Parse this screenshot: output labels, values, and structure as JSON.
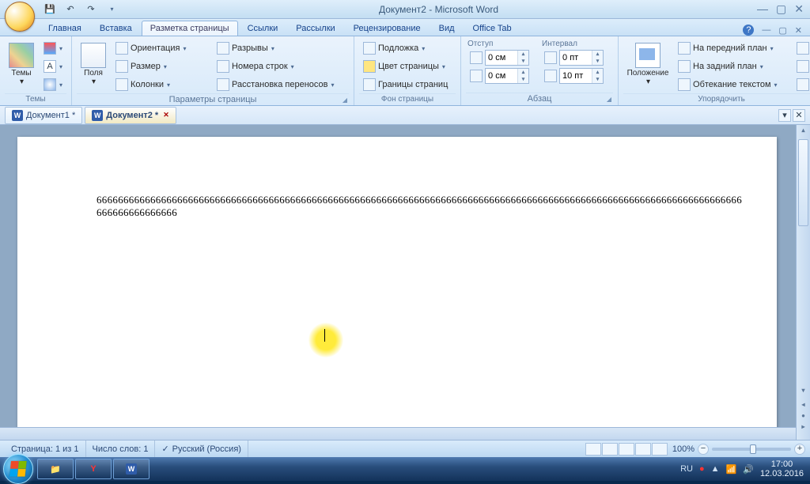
{
  "title": "Документ2 - Microsoft Word",
  "tabs": {
    "items": [
      "Главная",
      "Вставка",
      "Разметка страницы",
      "Ссылки",
      "Рассылки",
      "Рецензирование",
      "Вид",
      "Office Tab"
    ],
    "active": 2
  },
  "groups": {
    "themes": {
      "label": "Темы",
      "big": "Темы"
    },
    "page": {
      "label": "Параметры страницы",
      "big": "Поля",
      "orient": "Ориентация",
      "size": "Размер",
      "cols": "Колонки",
      "breaks": "Разрывы",
      "lines": "Номера строк",
      "hyphen": "Расстановка переносов"
    },
    "bg": {
      "label": "Фон страницы",
      "water": "Подложка",
      "color": "Цвет страницы",
      "border": "Границы страниц"
    },
    "para": {
      "label": "Абзац",
      "indent": "Отступ",
      "spacing": "Интервал",
      "left": "0 см",
      "right": "0 см",
      "before": "0 пт",
      "after": "10 пт"
    },
    "arrange": {
      "label": "Упорядочить",
      "pos": "Положение",
      "front": "На передний план",
      "back": "На задний план",
      "wrap": "Обтекание текстом"
    }
  },
  "docTabs": [
    {
      "name": "Документ1 *",
      "active": false
    },
    {
      "name": "Документ2 *",
      "active": true
    }
  ],
  "content": "666666666666666666666666666666666666666666666666666666666666666666666666666666666666666666666666666666666666666666666666666666666666666",
  "status": {
    "page": "Страница: 1 из 1",
    "words": "Число слов: 1",
    "lang": "Русский (Россия)",
    "zoom": "100%"
  },
  "tray": {
    "lang": "RU",
    "time": "17:00",
    "date": "12.03.2016"
  }
}
